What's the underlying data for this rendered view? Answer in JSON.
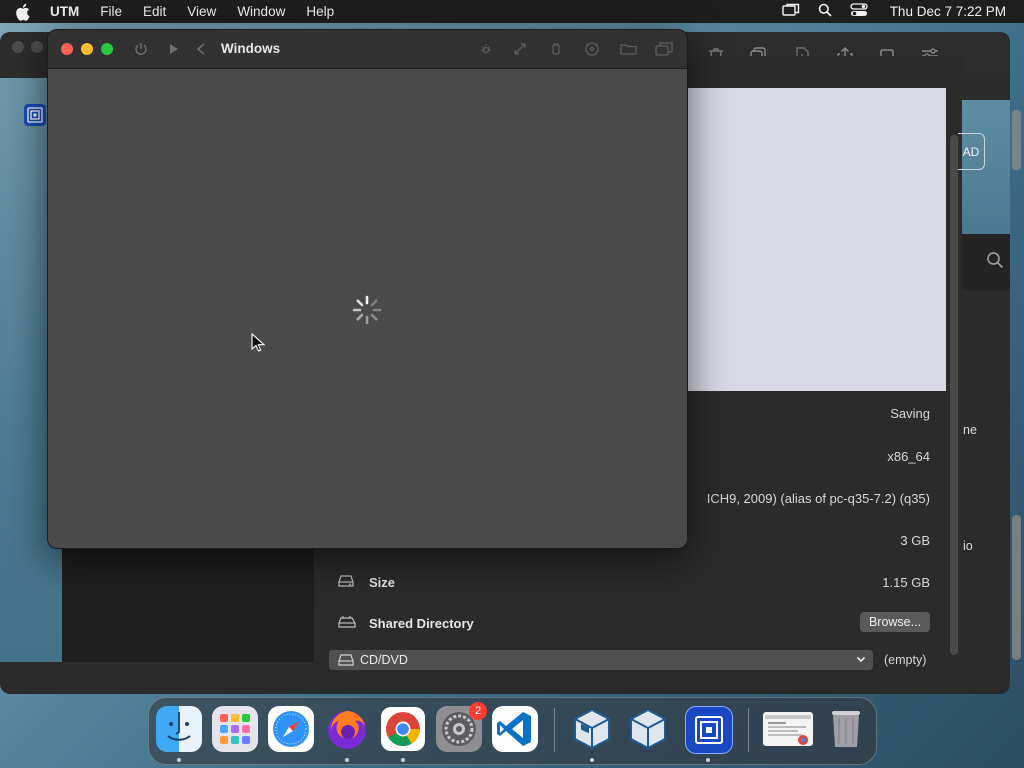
{
  "menubar": {
    "app_name": "UTM",
    "menus": [
      "File",
      "Edit",
      "View",
      "Window",
      "Help"
    ],
    "clock": "Thu Dec 7  7:22 PM"
  },
  "vm_window": {
    "title": "Windows"
  },
  "main_window": {
    "add_button_fragment": "AD",
    "right_fragment_texts": [
      "ne",
      "io"
    ]
  },
  "details": {
    "rows": [
      {
        "label": "",
        "value": "Saving"
      },
      {
        "label": "",
        "value": "x86_64"
      },
      {
        "label": "",
        "value": "ICH9, 2009) (alias of pc-q35-7.2) (q35)"
      },
      {
        "label": "",
        "value": "3 GB"
      },
      {
        "label": "Size",
        "value": "1.15 GB",
        "icon": "hard-drive-icon"
      },
      {
        "label": "Shared Directory",
        "button": "Browse...",
        "icon": "shared-drive-icon"
      }
    ],
    "cd_dvd": {
      "label": "CD/DVD",
      "value": "(empty)"
    }
  },
  "dock": {
    "items": [
      {
        "name": "Finder",
        "icon": "finder-icon",
        "running": true
      },
      {
        "name": "Launchpad",
        "icon": "launchpad-icon",
        "running": false
      },
      {
        "name": "Safari",
        "icon": "safari-icon",
        "running": false
      },
      {
        "name": "Firefox",
        "icon": "firefox-icon",
        "running": true
      },
      {
        "name": "Chrome",
        "icon": "chrome-icon",
        "running": true
      },
      {
        "name": "System Settings",
        "icon": "settings-icon",
        "running": false,
        "badge": "2"
      },
      {
        "name": "Visual Studio Code",
        "icon": "vscode-icon",
        "running": false
      },
      {
        "name": "VirtualBox",
        "icon": "virtualbox-icon",
        "running": true
      },
      {
        "name": "VirtualBox",
        "icon": "virtualbox-icon",
        "running": false
      },
      {
        "name": "UTM",
        "icon": "utm-icon",
        "running": true
      },
      {
        "name": "Chrome window",
        "icon": "chrome-window-thumbnail-icon",
        "running": false
      },
      {
        "name": "Trash",
        "icon": "trash-icon",
        "running": false
      }
    ]
  }
}
